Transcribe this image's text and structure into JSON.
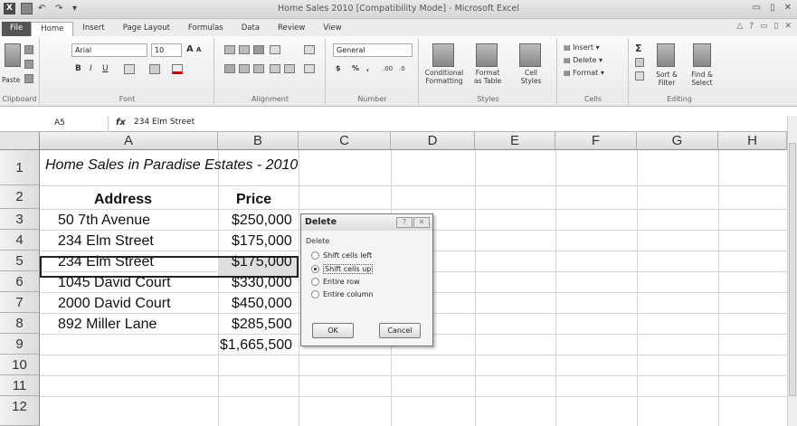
{
  "window": {
    "title": "Home Sales 2010  [Compatibility Mode]  -  Microsoft Excel",
    "xl_logo": "X",
    "qat_undo": "↶",
    "qat_redo": "↷",
    "qat_customize": "▾",
    "minimize": "▭",
    "restore": "▯",
    "close": "✕"
  },
  "tabs": [
    "File",
    "Home",
    "Insert",
    "Page Layout",
    "Formulas",
    "Data",
    "Review",
    "View"
  ],
  "tabs_right": [
    "△",
    "?",
    "▭",
    "▯",
    "✕"
  ],
  "ribbon": {
    "clipboard": {
      "paste": "Paste",
      "label": "Clipboard"
    },
    "font": {
      "name": "Arial",
      "size": "10",
      "grow": "A",
      "shrink": "A",
      "bold": "B",
      "italic": "I",
      "underline": "U",
      "label": "Font"
    },
    "alignment": {
      "label": "Alignment"
    },
    "number": {
      "format": "General",
      "currency": "$",
      "percent": "%",
      "comma": ",",
      "inc_decimal": ".00",
      "dec_decimal": ".0",
      "label": "Number"
    },
    "styles": {
      "conditional": "Conditional",
      "conditional2": "Formatting",
      "format_table": "Format",
      "format_table2": "as Table",
      "cell_styles": "Cell",
      "cell_styles2": "Styles",
      "label": "Styles"
    },
    "cells": {
      "insert": "Insert",
      "delete": "Delete",
      "format": "Format",
      "label": "Cells"
    },
    "editing": {
      "sum": "Σ",
      "sort": "Sort &",
      "sort2": "Filter",
      "find": "Find &",
      "find2": "Select",
      "label": "Editing"
    }
  },
  "formula_bar": {
    "name_box": "A5",
    "fx": "fx",
    "content": "234 Elm Street"
  },
  "columns": [
    "A",
    "B",
    "C",
    "D",
    "E",
    "F",
    "G",
    "H"
  ],
  "rows": [
    "1",
    "2",
    "3",
    "4",
    "5",
    "6",
    "7",
    "8",
    "9",
    "10",
    "11",
    "12"
  ],
  "sheet": {
    "title": "Home Sales in Paradise Estates - 2010",
    "header_address": "Address",
    "header_price": "Price",
    "addresses": [
      "50 7th Avenue",
      "234 Elm Street",
      "234 Elm Street",
      "1045 David Court",
      "2000 David Court",
      "892 Miller Lane"
    ],
    "prices": [
      "$250,000",
      "$175,000",
      "$175,000",
      "$330,000",
      "$450,000",
      "$285,500"
    ],
    "total": "$1,665,500"
  },
  "dialog": {
    "title": "Delete",
    "help": "?",
    "close": "✕",
    "group_label": "Delete",
    "options": [
      "Shift cells left",
      "Shift cells up",
      "Entire row",
      "Entire column"
    ],
    "selected_option": "Shift cells up",
    "ok": "OK",
    "cancel": "Cancel"
  }
}
